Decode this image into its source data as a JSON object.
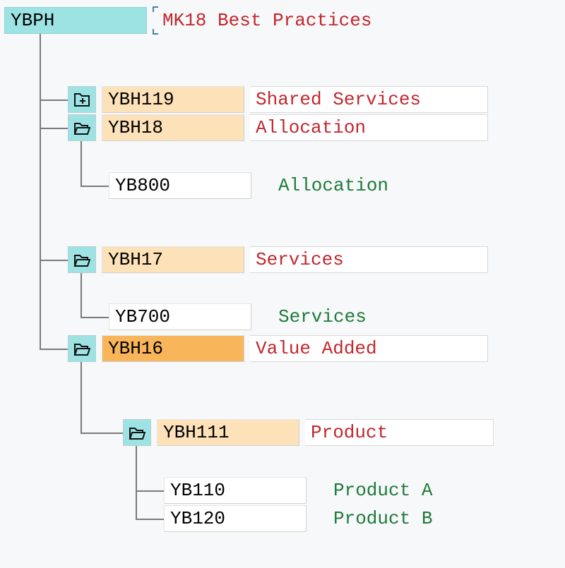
{
  "root": {
    "code": "YBPH",
    "desc": "MK18 Best Practices"
  },
  "nodes": {
    "ybh119": {
      "code": "YBH119",
      "desc": "Shared Services"
    },
    "ybh18": {
      "code": "YBH18",
      "desc": "Allocation"
    },
    "yb800": {
      "code": "YB800",
      "desc": "Allocation"
    },
    "ybh17": {
      "code": "YBH17",
      "desc": "Services"
    },
    "yb700": {
      "code": "YB700",
      "desc": "Services"
    },
    "ybh16": {
      "code": "YBH16",
      "desc": "Value Added"
    },
    "ybh111": {
      "code": "YBH111",
      "desc": "Product"
    },
    "yb110": {
      "code": "YB110",
      "desc": "Product A"
    },
    "yb120": {
      "code": "YB120",
      "desc": "Product B"
    }
  }
}
